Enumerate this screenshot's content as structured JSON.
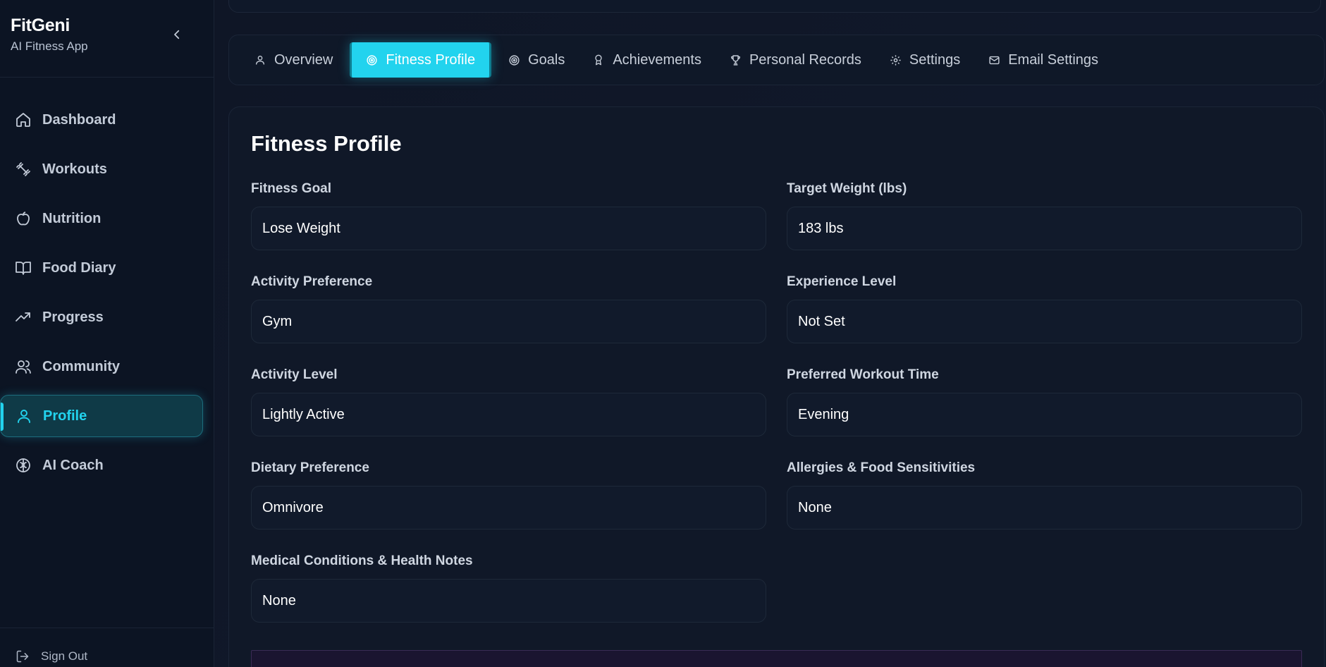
{
  "brand": {
    "title": "FitGeni",
    "subtitle": "AI Fitness App"
  },
  "sidebar": {
    "items": [
      {
        "label": "Dashboard",
        "icon": "home-icon"
      },
      {
        "label": "Workouts",
        "icon": "dumbbell-icon"
      },
      {
        "label": "Nutrition",
        "icon": "apple-icon"
      },
      {
        "label": "Food Diary",
        "icon": "book-icon"
      },
      {
        "label": "Progress",
        "icon": "trending-up-icon"
      },
      {
        "label": "Community",
        "icon": "users-icon"
      },
      {
        "label": "Profile",
        "icon": "user-icon",
        "active": true
      },
      {
        "label": "AI Coach",
        "icon": "brain-icon"
      }
    ],
    "sign_out": "Sign Out"
  },
  "tabs": [
    {
      "label": "Overview",
      "icon": "user-icon"
    },
    {
      "label": "Fitness Profile",
      "icon": "target-icon",
      "active": true
    },
    {
      "label": "Goals",
      "icon": "target-icon"
    },
    {
      "label": "Achievements",
      "icon": "award-icon"
    },
    {
      "label": "Personal Records",
      "icon": "trophy-icon"
    },
    {
      "label": "Settings",
      "icon": "gear-icon"
    },
    {
      "label": "Email Settings",
      "icon": "mail-icon"
    }
  ],
  "profile": {
    "title": "Fitness Profile",
    "fields": [
      {
        "label": "Fitness Goal",
        "value": "Lose Weight"
      },
      {
        "label": "Target Weight (lbs)",
        "value": "183 lbs"
      },
      {
        "label": "Activity Preference",
        "value": "Gym"
      },
      {
        "label": "Experience Level",
        "value": "Not Set"
      },
      {
        "label": "Activity Level",
        "value": "Lightly Active"
      },
      {
        "label": "Preferred Workout Time",
        "value": "Evening"
      },
      {
        "label": "Dietary Preference",
        "value": "Omnivore"
      },
      {
        "label": "Allergies & Food Sensitivities",
        "value": "None"
      },
      {
        "label": "Medical Conditions & Health Notes",
        "value": "None"
      }
    ]
  },
  "colors": {
    "accent": "#22d3ee",
    "background": "#0d1321",
    "sidebar": "#0c1423"
  }
}
